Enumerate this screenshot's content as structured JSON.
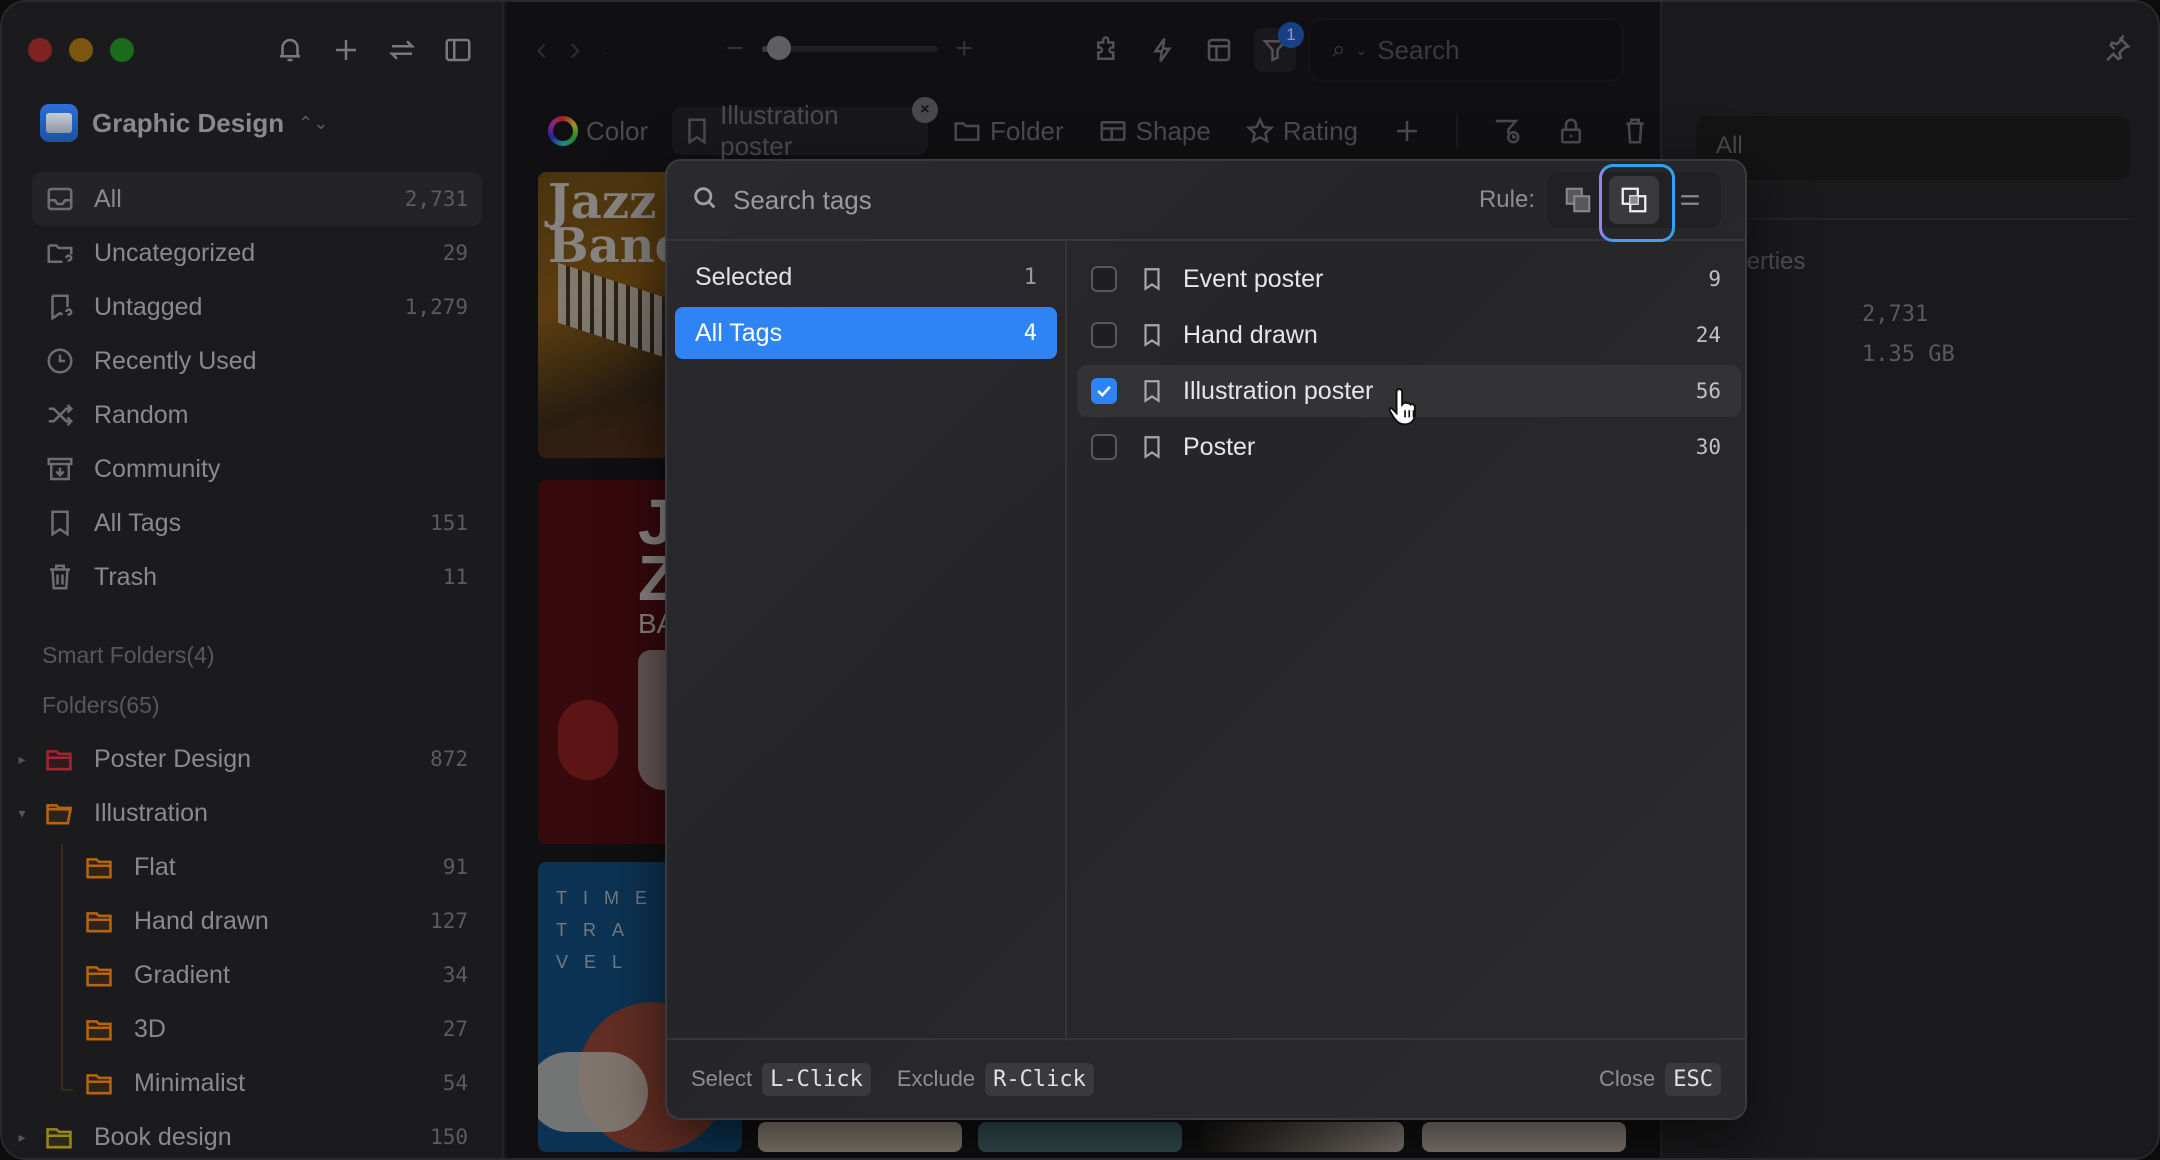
{
  "window": {
    "traffic_lights": [
      "close",
      "minimize",
      "maximize"
    ]
  },
  "sidebar": {
    "tools": [
      "bell-icon",
      "plus-icon",
      "swap-icon",
      "sidebar-toggle-icon"
    ],
    "library_name": "Graphic Design",
    "nav_items": [
      {
        "label": "All",
        "count": "2,731",
        "icon": "inbox-icon",
        "active": true
      },
      {
        "label": "Uncategorized",
        "count": "29",
        "icon": "folder-question-icon"
      },
      {
        "label": "Untagged",
        "count": "1,279",
        "icon": "tag-question-icon"
      },
      {
        "label": "Recently Used",
        "count": "",
        "icon": "clock-icon"
      },
      {
        "label": "Random",
        "count": "",
        "icon": "shuffle-icon"
      },
      {
        "label": "Community",
        "count": "",
        "icon": "archive-download-icon"
      },
      {
        "label": "All Tags",
        "count": "151",
        "icon": "bookmark-icon"
      },
      {
        "label": "Trash",
        "count": "11",
        "icon": "trash-icon"
      }
    ],
    "smart_folders_label": "Smart Folders(4)",
    "folders_label": "Folders(65)",
    "folders": [
      {
        "label": "Poster Design",
        "count": "872",
        "color": "#a3262e",
        "expanded": false,
        "level": 0
      },
      {
        "label": "Illustration",
        "count": "",
        "color": "#b5650f",
        "expanded": true,
        "level": 0
      },
      {
        "label": "Flat",
        "count": "91",
        "color": "#b5650f",
        "level": 1
      },
      {
        "label": "Hand drawn",
        "count": "127",
        "color": "#b5650f",
        "level": 1
      },
      {
        "label": "Gradient",
        "count": "34",
        "color": "#b5650f",
        "level": 1
      },
      {
        "label": "3D",
        "count": "27",
        "color": "#b5650f",
        "level": 1
      },
      {
        "label": "Minimalist",
        "count": "54",
        "color": "#b5650f",
        "level": 1
      },
      {
        "label": "Book design",
        "count": "150",
        "color": "#9c8615",
        "expanded": false,
        "level": 0
      }
    ]
  },
  "toolbar": {
    "zoom_level": 0.1,
    "filter_badge": "1",
    "search_placeholder": "Search"
  },
  "filterbar": {
    "color_label": "Color",
    "active_tag_label": "Illustration poster",
    "folder_label": "Folder",
    "shape_label": "Shape",
    "rating_label": "Rating"
  },
  "right_panel": {
    "input_value": "All",
    "heading": "Properties",
    "props": [
      "2,731",
      "1.35 GB"
    ]
  },
  "tag_popup": {
    "search_placeholder": "Search tags",
    "rule_label": "Rule:",
    "categories": [
      {
        "label": "Selected",
        "count": "1",
        "active": false
      },
      {
        "label": "All Tags",
        "count": "4",
        "active": true
      }
    ],
    "tags": [
      {
        "label": "Event poster",
        "count": "9",
        "checked": false
      },
      {
        "label": "Hand drawn",
        "count": "24",
        "checked": false
      },
      {
        "label": "Illustration poster",
        "count": "56",
        "checked": true
      },
      {
        "label": "Poster",
        "count": "30",
        "checked": false
      }
    ],
    "footer": {
      "select_label": "Select",
      "select_key": "L-Click",
      "exclude_label": "Exclude",
      "exclude_key": "R-Click",
      "close_label": "Close",
      "close_key": "ESC"
    }
  },
  "colors": {
    "accent": "#2f84f5",
    "badge": "#1f5fc6",
    "rule_focus": "#2ea3f2"
  }
}
